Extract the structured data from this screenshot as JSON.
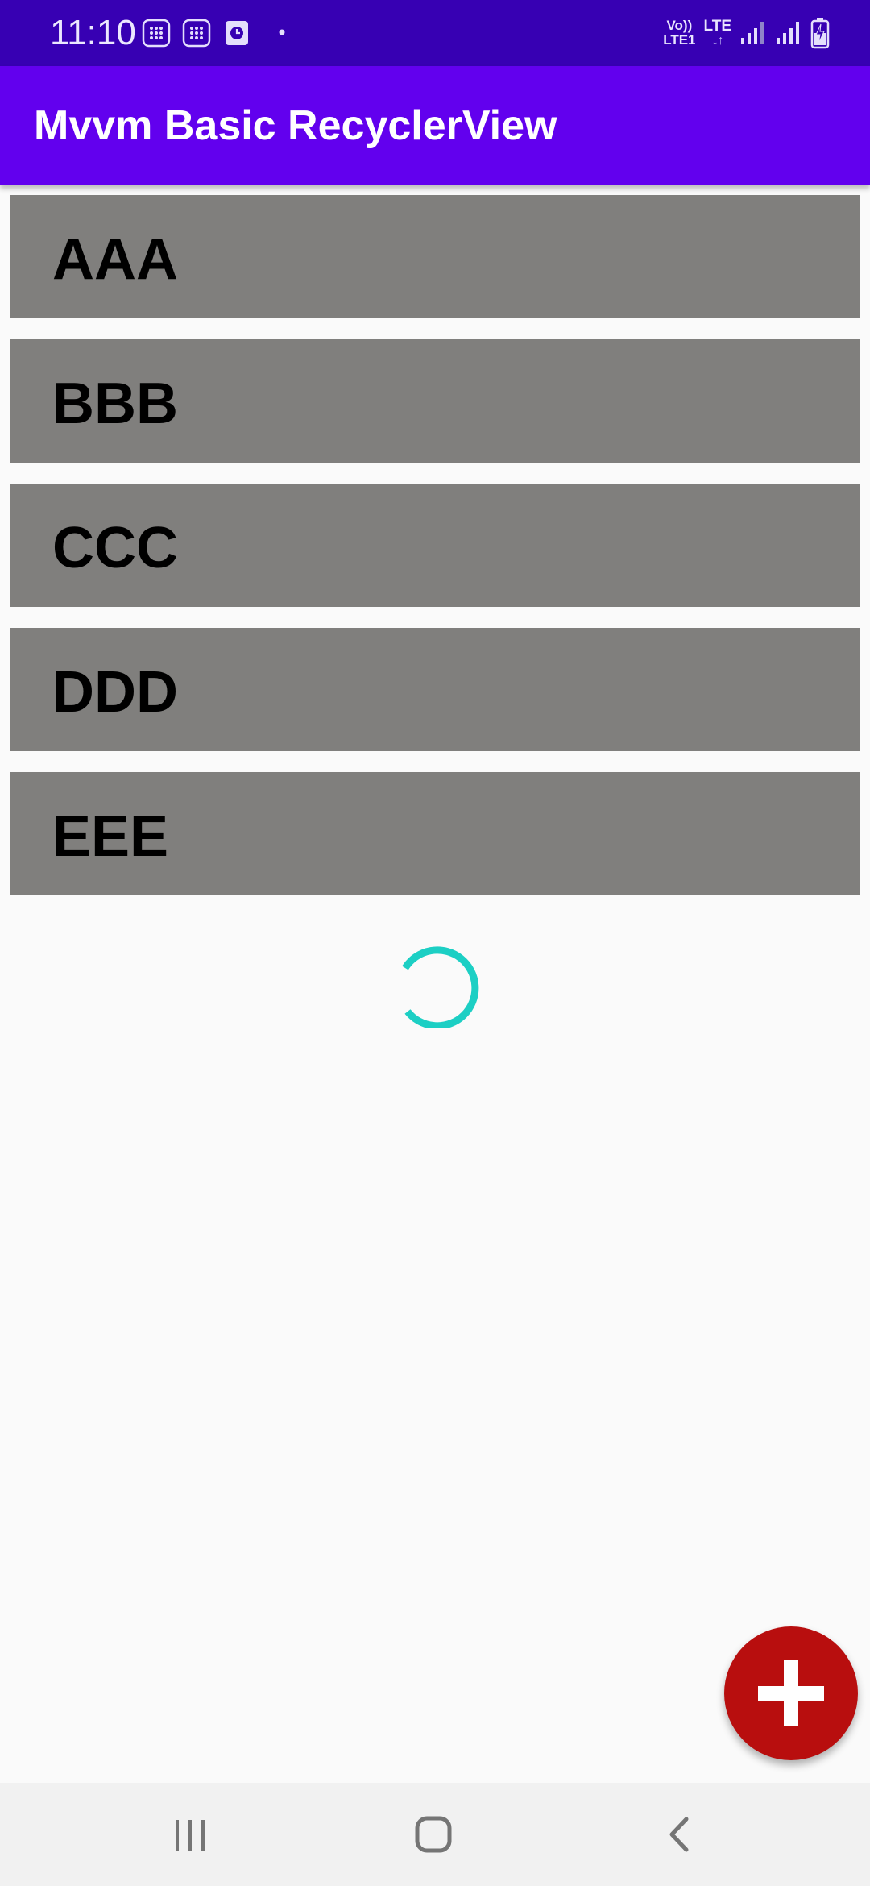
{
  "status_bar": {
    "time": "11:10",
    "volte_line1": "Vo))",
    "volte_line2": "LTE1",
    "network_type": "LTE",
    "network_arrows": "↓↑",
    "icons": [
      "keypad-notification-icon",
      "keypad-notification-icon",
      "clock-notification-icon",
      "dot-icon",
      "signal-icon",
      "signal-icon",
      "battery-charging-icon"
    ]
  },
  "app_bar": {
    "title": "Mvvm Basic RecyclerView"
  },
  "list": {
    "items": [
      {
        "label": "AAA"
      },
      {
        "label": "BBB"
      },
      {
        "label": "CCC"
      },
      {
        "label": "DDD"
      },
      {
        "label": "EEE"
      }
    ]
  },
  "loading": {
    "icon": "progress-spinner-icon",
    "color": "#1ccfc4"
  },
  "fab": {
    "icon": "plus-icon",
    "color": "#b80e0e"
  },
  "nav_bar": {
    "buttons": [
      "recent-apps-icon",
      "home-icon",
      "back-icon"
    ]
  },
  "colors": {
    "status_bar": "#3700b3",
    "app_bar": "#6200ee",
    "list_item": "#807f7d",
    "background": "#fafafa"
  }
}
